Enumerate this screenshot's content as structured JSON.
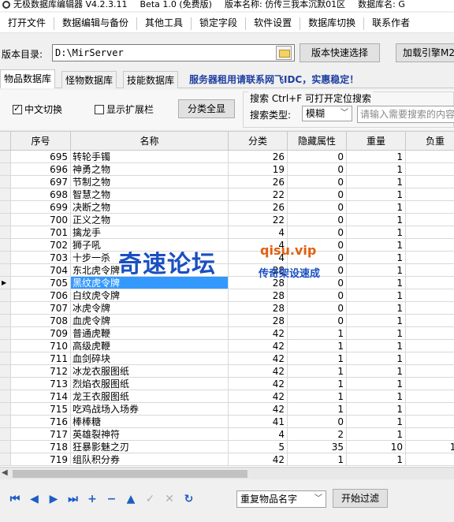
{
  "titlebar": {
    "app_title": "无极数据库编辑器 V4.2.3.11",
    "beta": "Beta 1.0 (免费版)",
    "version_name": "版本名称: 仿传三我本沉默01区",
    "db_name": "数据库名: G"
  },
  "menubar": {
    "items": [
      "打开文件",
      "数据编辑与备份",
      "其他工具",
      "锁定字段",
      "软件设置",
      "数据库切换",
      "联系作者"
    ]
  },
  "dirbar": {
    "label": "版本目录:",
    "path": "D:\\MirServer",
    "quick_select": "版本快速选择",
    "load_engine": "加载引擎M2"
  },
  "tabs": {
    "items": [
      "物品数据库",
      "怪物数据库",
      "技能数据库"
    ],
    "active": 0,
    "ad_text": "服务器租用请联系网飞IDC，实惠稳定！"
  },
  "filters": {
    "chinese_toggle": "中文切换",
    "chinese_checked": true,
    "show_expand": "显示扩展栏",
    "show_expand_checked": false,
    "show_all_categories": "分类全显",
    "search_legend": "搜索  Ctrl+F 可打开定位搜索",
    "search_type_label": "搜索类型:",
    "search_type_value": "模糊",
    "search_placeholder": "请输入需要搜索的内容"
  },
  "grid": {
    "columns": [
      "序号",
      "名称",
      "分类",
      "隐藏属性",
      "重量",
      "负重"
    ],
    "selected_index": 10,
    "rows": [
      [
        "695",
        "转轮手镯",
        "26",
        "0",
        "1",
        ""
      ],
      [
        "696",
        "神勇之物",
        "19",
        "0",
        "1",
        ""
      ],
      [
        "697",
        "节制之物",
        "26",
        "0",
        "1",
        ""
      ],
      [
        "698",
        "智慧之物",
        "22",
        "0",
        "1",
        ""
      ],
      [
        "699",
        "决断之物",
        "26",
        "0",
        "1",
        ""
      ],
      [
        "700",
        "正义之物",
        "22",
        "0",
        "1",
        ""
      ],
      [
        "701",
        "擒龙手",
        "4",
        "0",
        "1",
        ""
      ],
      [
        "702",
        "狮子吼",
        "4",
        "0",
        "1",
        ""
      ],
      [
        "703",
        "十步一杀",
        "4",
        "0",
        "1",
        ""
      ],
      [
        "704",
        "东北虎令牌",
        "28",
        "0",
        "1",
        ""
      ],
      [
        "705",
        "黑纹虎令牌",
        "28",
        "0",
        "1",
        ""
      ],
      [
        "706",
        "白纹虎令牌",
        "28",
        "0",
        "1",
        ""
      ],
      [
        "707",
        "冰虎令牌",
        "28",
        "0",
        "1",
        ""
      ],
      [
        "708",
        "血虎令牌",
        "28",
        "0",
        "1",
        ""
      ],
      [
        "709",
        "普通虎鞭",
        "42",
        "1",
        "1",
        ""
      ],
      [
        "710",
        "高级虎鞭",
        "42",
        "1",
        "1",
        ""
      ],
      [
        "711",
        "血剑碎块",
        "42",
        "1",
        "1",
        ""
      ],
      [
        "712",
        "冰龙衣服图纸",
        "42",
        "1",
        "1",
        ""
      ],
      [
        "713",
        "烈焰衣服图纸",
        "42",
        "1",
        "1",
        ""
      ],
      [
        "714",
        "龙王衣服图纸",
        "42",
        "1",
        "1",
        ""
      ],
      [
        "715",
        "吃鸡战场入场券",
        "42",
        "1",
        "1",
        ""
      ],
      [
        "716",
        "棒棒糖",
        "41",
        "0",
        "1",
        ""
      ],
      [
        "717",
        "英雄裂神符",
        "4",
        "2",
        "1",
        "9"
      ],
      [
        "718",
        "狂暴影魅之刃",
        "5",
        "35",
        "10",
        "13"
      ],
      [
        "719",
        "组队积分券",
        "42",
        "1",
        "1",
        ""
      ]
    ]
  },
  "bottom": {
    "nav_icons": [
      "first-record-icon",
      "prior-record-icon",
      "next-record-icon",
      "last-record-icon",
      "insert-record-icon",
      "delete-record-icon",
      "edit-record-icon",
      "post-record-icon",
      "cancel-record-icon",
      "refresh-record-icon"
    ],
    "nav_glyphs": [
      "⏮",
      "◀",
      "▶",
      "⏭",
      "+",
      "−",
      "▲",
      "✓",
      "✕",
      "↻"
    ],
    "duplicate_select": "重复物品名字",
    "filter_button": "开始过滤"
  },
  "watermark": {
    "main": "奇速论坛",
    "url": "qisu.vip",
    "sub": "传奇架设速成"
  }
}
